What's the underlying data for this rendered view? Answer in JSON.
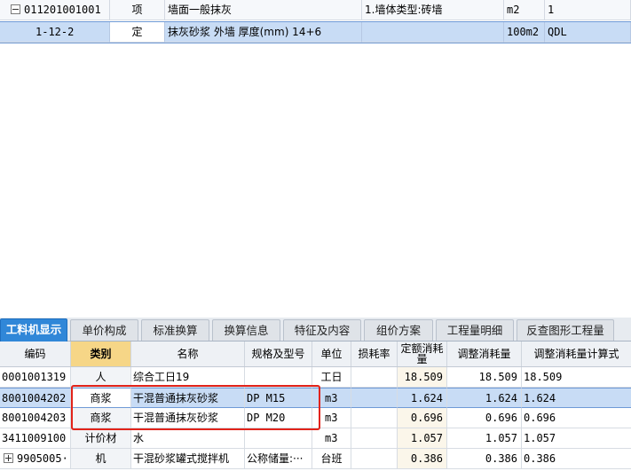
{
  "top_rows": [
    {
      "code": "011201001001",
      "type": "项",
      "name": "墙面一般抹灰",
      "feature": "1.墙体类型:砖墙",
      "unit": "m2",
      "qty": "1"
    },
    {
      "code": "1-12-2",
      "type": "定",
      "name": "抹灰砂浆 外墙 厚度(mm) 14+6",
      "feature": "",
      "unit": "100m2",
      "qty": "QDL"
    }
  ],
  "tabs": [
    "工料机显示",
    "单价构成",
    "标准换算",
    "换算信息",
    "特征及内容",
    "组价方案",
    "工程量明细",
    "反查图形工程量"
  ],
  "columns": {
    "code": "编码",
    "type": "类别",
    "name": "名称",
    "spec": "规格及型号",
    "unit": "单位",
    "loss": "损耗率",
    "quota_l1": "定额消耗",
    "quota_l2": "量",
    "adjusted": "调整消耗量",
    "formula": "调整消耗量计算式"
  },
  "rows": [
    {
      "code": "0001001319",
      "type": "人",
      "name": "综合工日19",
      "spec": "",
      "unit": "工日",
      "loss": "",
      "quota": "18.509",
      "adjusted": "18.509",
      "formula": "18.509"
    },
    {
      "code": "8001004202",
      "type": "商浆",
      "name": "干混普通抹灰砂浆",
      "spec": "DP M15",
      "unit": "m3",
      "loss": "",
      "quota": "1.624",
      "adjusted": "1.624",
      "formula": "1.624"
    },
    {
      "code": "8001004203",
      "type": "商浆",
      "name": "干混普通抹灰砂浆",
      "spec": "DP M20",
      "unit": "m3",
      "loss": "",
      "quota": "0.696",
      "adjusted": "0.696",
      "formula": "0.696"
    },
    {
      "code": "3411009100",
      "type": "计价材",
      "name": "水",
      "spec": "",
      "unit": "m3",
      "loss": "",
      "quota": "1.057",
      "adjusted": "1.057",
      "formula": "1.057"
    },
    {
      "code": "9905005···",
      "type": "机",
      "name": "干混砂浆罐式搅拌机",
      "spec": "公称储量:···",
      "unit": "台班",
      "loss": "",
      "quota": "0.386",
      "adjusted": "0.386",
      "formula": "0.386"
    }
  ]
}
